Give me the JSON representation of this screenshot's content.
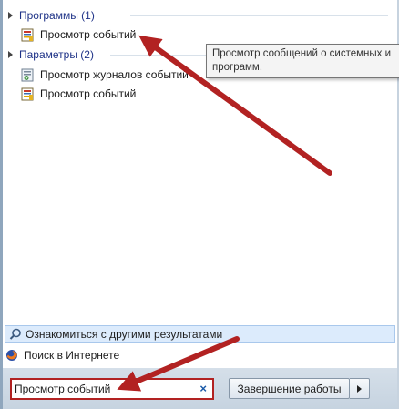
{
  "groups": [
    {
      "header": "Программы (1)",
      "items": [
        {
          "label": "Просмотр событий",
          "icon": "event-viewer-icon"
        }
      ]
    },
    {
      "header": "Параметры (2)",
      "items": [
        {
          "label": "Просмотр журналов событий",
          "icon": "event-log-settings-icon"
        },
        {
          "label": "Просмотр событий",
          "icon": "event-viewer-icon"
        }
      ]
    }
  ],
  "tooltip": {
    "line1": "Просмотр сообщений о системных и",
    "line2": "программ."
  },
  "more_results_label": "Ознакомиться с другими результатами",
  "web_search_label": "Поиск в Интернете",
  "search": {
    "value": "Просмотр событий",
    "clear_glyph": "×"
  },
  "shutdown_label": "Завершение работы",
  "colors": {
    "group_header": "#1e3287",
    "annotation_arrow": "#b22222",
    "highlight": "#dcebfc"
  }
}
